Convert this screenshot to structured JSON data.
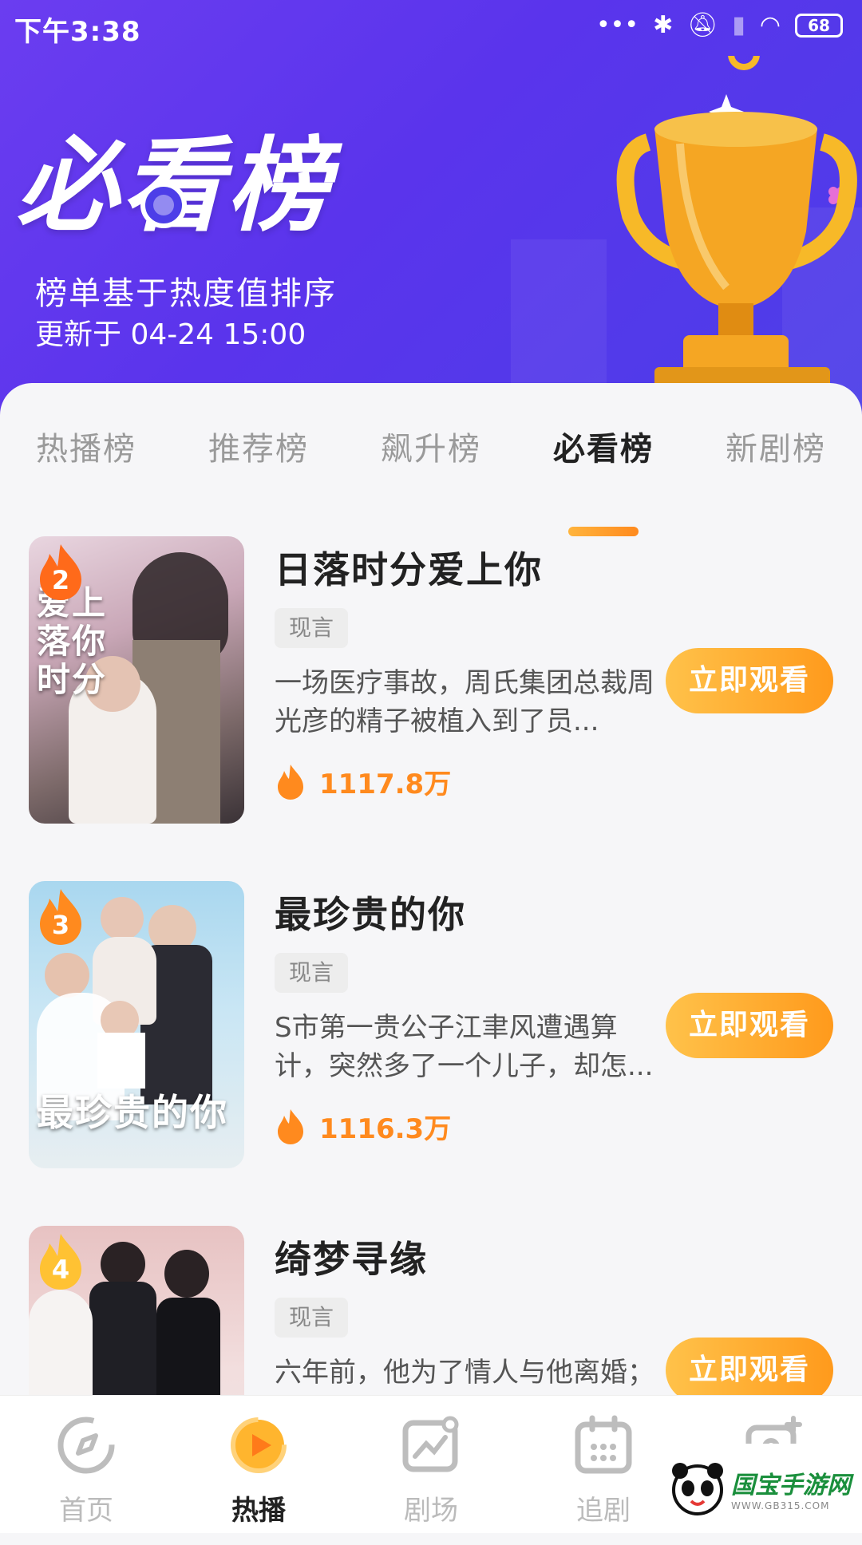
{
  "status": {
    "time": "下午3:38",
    "battery": "68"
  },
  "header": {
    "title": "必看榜",
    "subtitle": "榜单基于热度值排序",
    "update_time": "更新于 04-24 15:00"
  },
  "tabs": [
    {
      "label": "热播榜"
    },
    {
      "label": "推荐榜"
    },
    {
      "label": "飙升榜"
    },
    {
      "label": "必看榜",
      "active": true
    },
    {
      "label": "新剧榜"
    }
  ],
  "items": [
    {
      "rank": "2",
      "title": "日落时分爱上你",
      "tag": "现言",
      "desc": "一场医疗事故，周氏集团总裁周光彦的精子被植入到了员...",
      "heat": "1117.8万",
      "button": "立即观看",
      "poster_text": "爱上落你时分"
    },
    {
      "rank": "3",
      "title": "最珍贵的你",
      "tag": "现言",
      "desc": "S市第一贵公子江聿风遭遇算计，突然多了一个儿子，却怎...",
      "heat": "1116.3万",
      "button": "立即观看",
      "poster_text": "最珍贵的你"
    },
    {
      "rank": "4",
      "title": "绮梦寻缘",
      "tag": "现言",
      "desc": "六年前，他为了情人与他离婚；",
      "heat": "",
      "button": "立即观看",
      "poster_text": ""
    }
  ],
  "nav": [
    {
      "label": "首页",
      "icon": "compass-icon"
    },
    {
      "label": "热播",
      "icon": "play-icon",
      "active": true
    },
    {
      "label": "剧场",
      "icon": "theater-icon"
    },
    {
      "label": "追剧",
      "icon": "calendar-icon"
    },
    {
      "label": "",
      "icon": "profile-icon"
    }
  ],
  "watermark": {
    "text": "国宝手游网",
    "sub": "WWW.GB315.COM"
  },
  "colors": {
    "accent": "#ff9a1c",
    "header": "#5a34ec"
  }
}
